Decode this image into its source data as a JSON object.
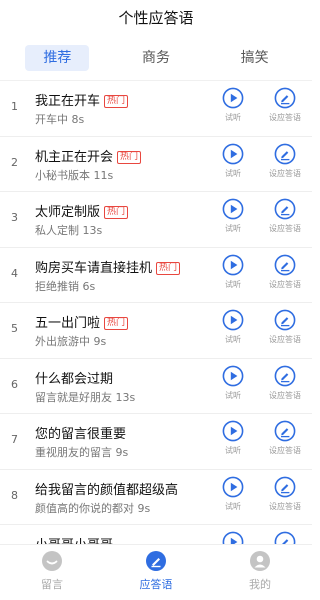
{
  "header": {
    "title": "个性应答语"
  },
  "tabs": [
    {
      "label": "推荐",
      "active": true
    },
    {
      "label": "商务",
      "active": false
    },
    {
      "label": "搞笑",
      "active": false
    }
  ],
  "list": {
    "listen_label": "试听",
    "set_label": "设应答语",
    "hot_label": "热门",
    "items": [
      {
        "index": "1",
        "name": "我正在开车",
        "hot": true,
        "desc": "开车中 8s"
      },
      {
        "index": "2",
        "name": "机主正在开会",
        "hot": true,
        "desc": "小秘书版本 11s"
      },
      {
        "index": "3",
        "name": "太师定制版",
        "hot": true,
        "desc": "私人定制 13s"
      },
      {
        "index": "4",
        "name": "购房买车请直接挂机",
        "hot": true,
        "desc": "拒绝推销 6s"
      },
      {
        "index": "5",
        "name": "五一出门啦",
        "hot": true,
        "desc": "外出旅游中 9s"
      },
      {
        "index": "6",
        "name": "什么都会过期",
        "hot": false,
        "desc": "留言就是好朋友 13s"
      },
      {
        "index": "7",
        "name": "您的留言很重要",
        "hot": false,
        "desc": "重视朋友的留言 9s"
      },
      {
        "index": "8",
        "name": "给我留言的颜值都超级高",
        "hot": false,
        "desc": "颜值高的你说的都对 9s"
      },
      {
        "index": "9",
        "name": "小哥哥小哥哥",
        "hot": false,
        "desc": ""
      }
    ]
  },
  "bottom_nav": [
    {
      "label": "留言",
      "icon": "message-icon",
      "active": false
    },
    {
      "label": "应答语",
      "icon": "reply-icon",
      "active": true
    },
    {
      "label": "我的",
      "icon": "profile-icon",
      "active": false
    }
  ],
  "colors": {
    "accent": "#2f6de1",
    "hot": "#e8473f"
  }
}
